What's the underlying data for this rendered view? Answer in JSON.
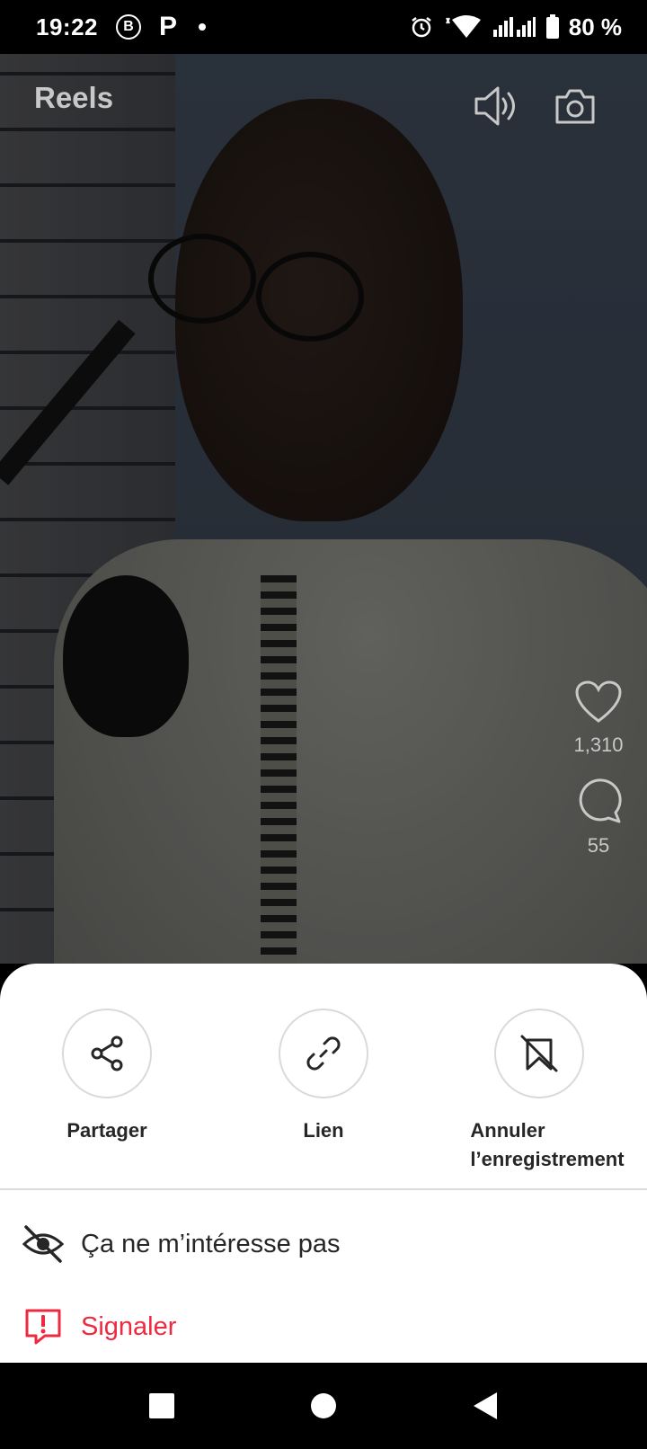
{
  "status_bar": {
    "time": "19:22",
    "badge_b": "B",
    "badge_p": "P",
    "battery": "80 %"
  },
  "reels": {
    "title": "Reels",
    "likes": "1,310",
    "comments": "55"
  },
  "sheet": {
    "share_label": "Partager",
    "link_label": "Lien",
    "unsave_label_line1": "Annuler",
    "unsave_label_line2": "l’enregistrement",
    "not_interested_label": "Ça ne m’intéresse pas",
    "report_label": "Signaler"
  },
  "colors": {
    "danger": "#ed2a3f",
    "text": "#262626"
  },
  "icons": [
    "alarm-icon",
    "wifi-icon",
    "signal-icon",
    "battery-icon",
    "sound-icon",
    "camera-icon",
    "heart-icon",
    "comment-icon",
    "share-icon",
    "link-icon",
    "unsave-icon",
    "eye-off-icon",
    "report-icon",
    "square-nav-icon",
    "home-nav-icon",
    "back-nav-icon"
  ]
}
